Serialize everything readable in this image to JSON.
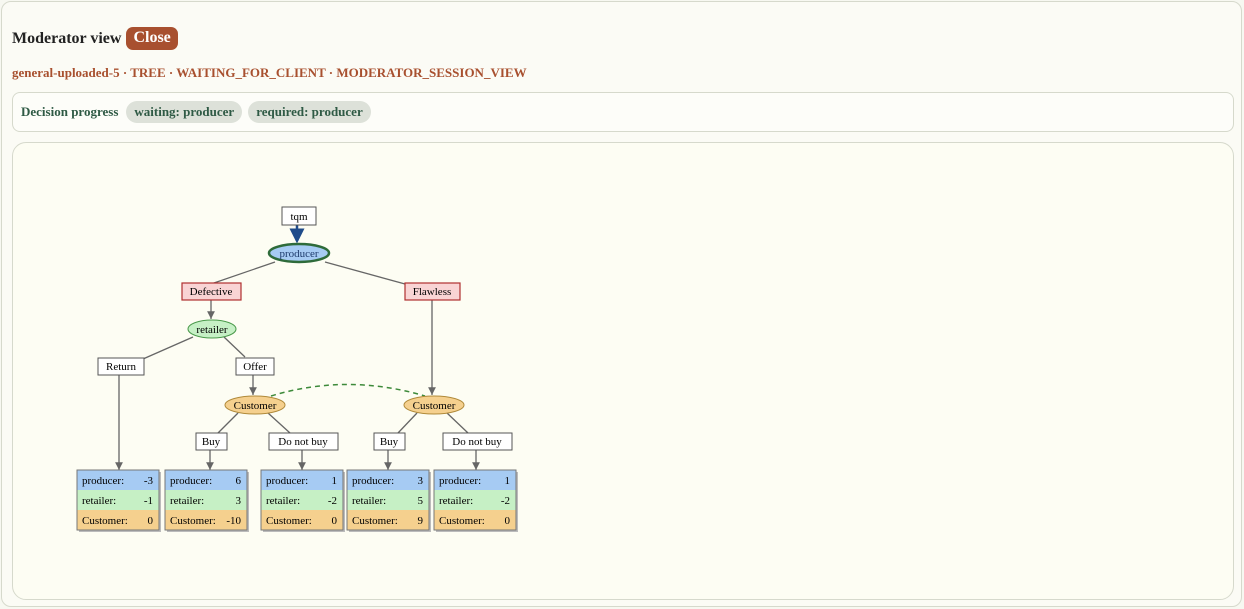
{
  "header": {
    "title": "Moderator view",
    "close_label": "Close",
    "subtitle": "general-uploaded-5 · TREE · WAITING_FOR_CLIENT · MODERATOR_SESSION_VIEW"
  },
  "progress": {
    "label": "Decision progress",
    "pills": [
      "waiting: producer",
      "required: producer"
    ]
  },
  "colors": {
    "producer": "#a6cbf3",
    "retailer": "#c6f0c5",
    "customer": "#f5d08e",
    "action": "#f9d4d4",
    "accent": "#a8502f"
  },
  "tree": {
    "root_label": "tqm",
    "nodes": {
      "producer": "producer",
      "retailer": "retailer",
      "customer_left": "Customer",
      "customer_right": "Customer"
    },
    "actions": {
      "defective": "Defective",
      "flawless": "Flawless",
      "return": "Return",
      "offer": "Offer",
      "buy_left": "Buy",
      "not_buy_left": "Do not buy",
      "buy_right": "Buy",
      "not_buy_right": "Do not buy"
    },
    "payoffs": [
      [
        {
          "name": "producer:",
          "value": "-3"
        },
        {
          "name": "retailer:",
          "value": "-1"
        },
        {
          "name": "Customer:",
          "value": "0"
        }
      ],
      [
        {
          "name": "producer:",
          "value": "6"
        },
        {
          "name": "retailer:",
          "value": "3"
        },
        {
          "name": "Customer:",
          "value": "-10"
        }
      ],
      [
        {
          "name": "producer:",
          "value": "1"
        },
        {
          "name": "retailer:",
          "value": "-2"
        },
        {
          "name": "Customer:",
          "value": "0"
        }
      ],
      [
        {
          "name": "producer:",
          "value": "3"
        },
        {
          "name": "retailer:",
          "value": "5"
        },
        {
          "name": "Customer:",
          "value": "9"
        }
      ],
      [
        {
          "name": "producer:",
          "value": "1"
        },
        {
          "name": "retailer:",
          "value": "-2"
        },
        {
          "name": "Customer:",
          "value": "0"
        }
      ]
    ]
  }
}
